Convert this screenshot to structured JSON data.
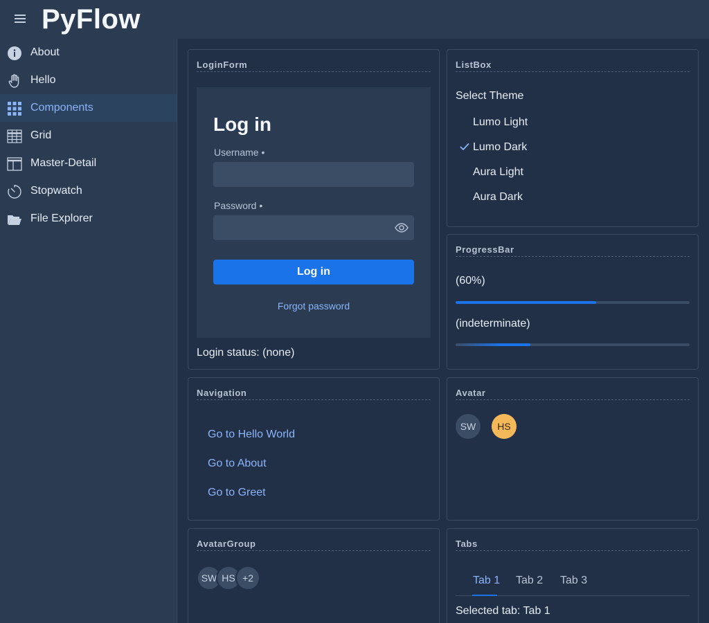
{
  "header": {
    "title": "PyFlow",
    "menu_icon": "hamburger-menu-icon"
  },
  "sidebar": {
    "items": [
      {
        "label": "About",
        "icon": "info-icon",
        "active": false
      },
      {
        "label": "Hello",
        "icon": "hand-icon",
        "active": false
      },
      {
        "label": "Components",
        "icon": "grid-dots-icon",
        "active": true
      },
      {
        "label": "Grid",
        "icon": "table-icon",
        "active": false
      },
      {
        "label": "Master-Detail",
        "icon": "layout-icon",
        "active": false
      },
      {
        "label": "Stopwatch",
        "icon": "stopwatch-icon",
        "active": false
      },
      {
        "label": "File Explorer",
        "icon": "folder-open-icon",
        "active": false
      }
    ]
  },
  "login_form": {
    "card_title": "LoginForm",
    "heading": "Log in",
    "username_label": "Username",
    "username_value": "",
    "password_label": "Password",
    "password_value": "",
    "required_marker": "•",
    "submit_label": "Log in",
    "forgot_label": "Forgot password",
    "status": "Login status: (none)"
  },
  "list_box": {
    "card_title": "ListBox",
    "label": "Select Theme",
    "items": [
      "Lumo Light",
      "Lumo Dark",
      "Aura Light",
      "Aura Dark"
    ],
    "selected": "Lumo Dark"
  },
  "progress_bar": {
    "card_title": "ProgressBar",
    "determinate_label": "(60%)",
    "determinate_value": 0.6,
    "indeterminate_label": "(indeterminate)"
  },
  "navigation": {
    "card_title": "Navigation",
    "links": [
      "Go to Hello World",
      "Go to About",
      "Go to Greet"
    ]
  },
  "avatar": {
    "card_title": "Avatar",
    "items": [
      {
        "initials": "SW",
        "color": "#3b4c65"
      },
      {
        "initials": "HS",
        "color": "#f6b95a"
      }
    ]
  },
  "avatar_group": {
    "card_title": "AvatarGroup",
    "items": [
      "SW",
      "HS",
      "+2"
    ]
  },
  "tabs": {
    "card_title": "Tabs",
    "items": [
      "Tab 1",
      "Tab 2",
      "Tab 3"
    ],
    "selected": "Tab 1",
    "status": "Selected tab: Tab 1"
  },
  "colors": {
    "accent": "#1a73e8",
    "link": "#8ab4f8",
    "background": "#223047",
    "surface": "#2b3b52"
  }
}
